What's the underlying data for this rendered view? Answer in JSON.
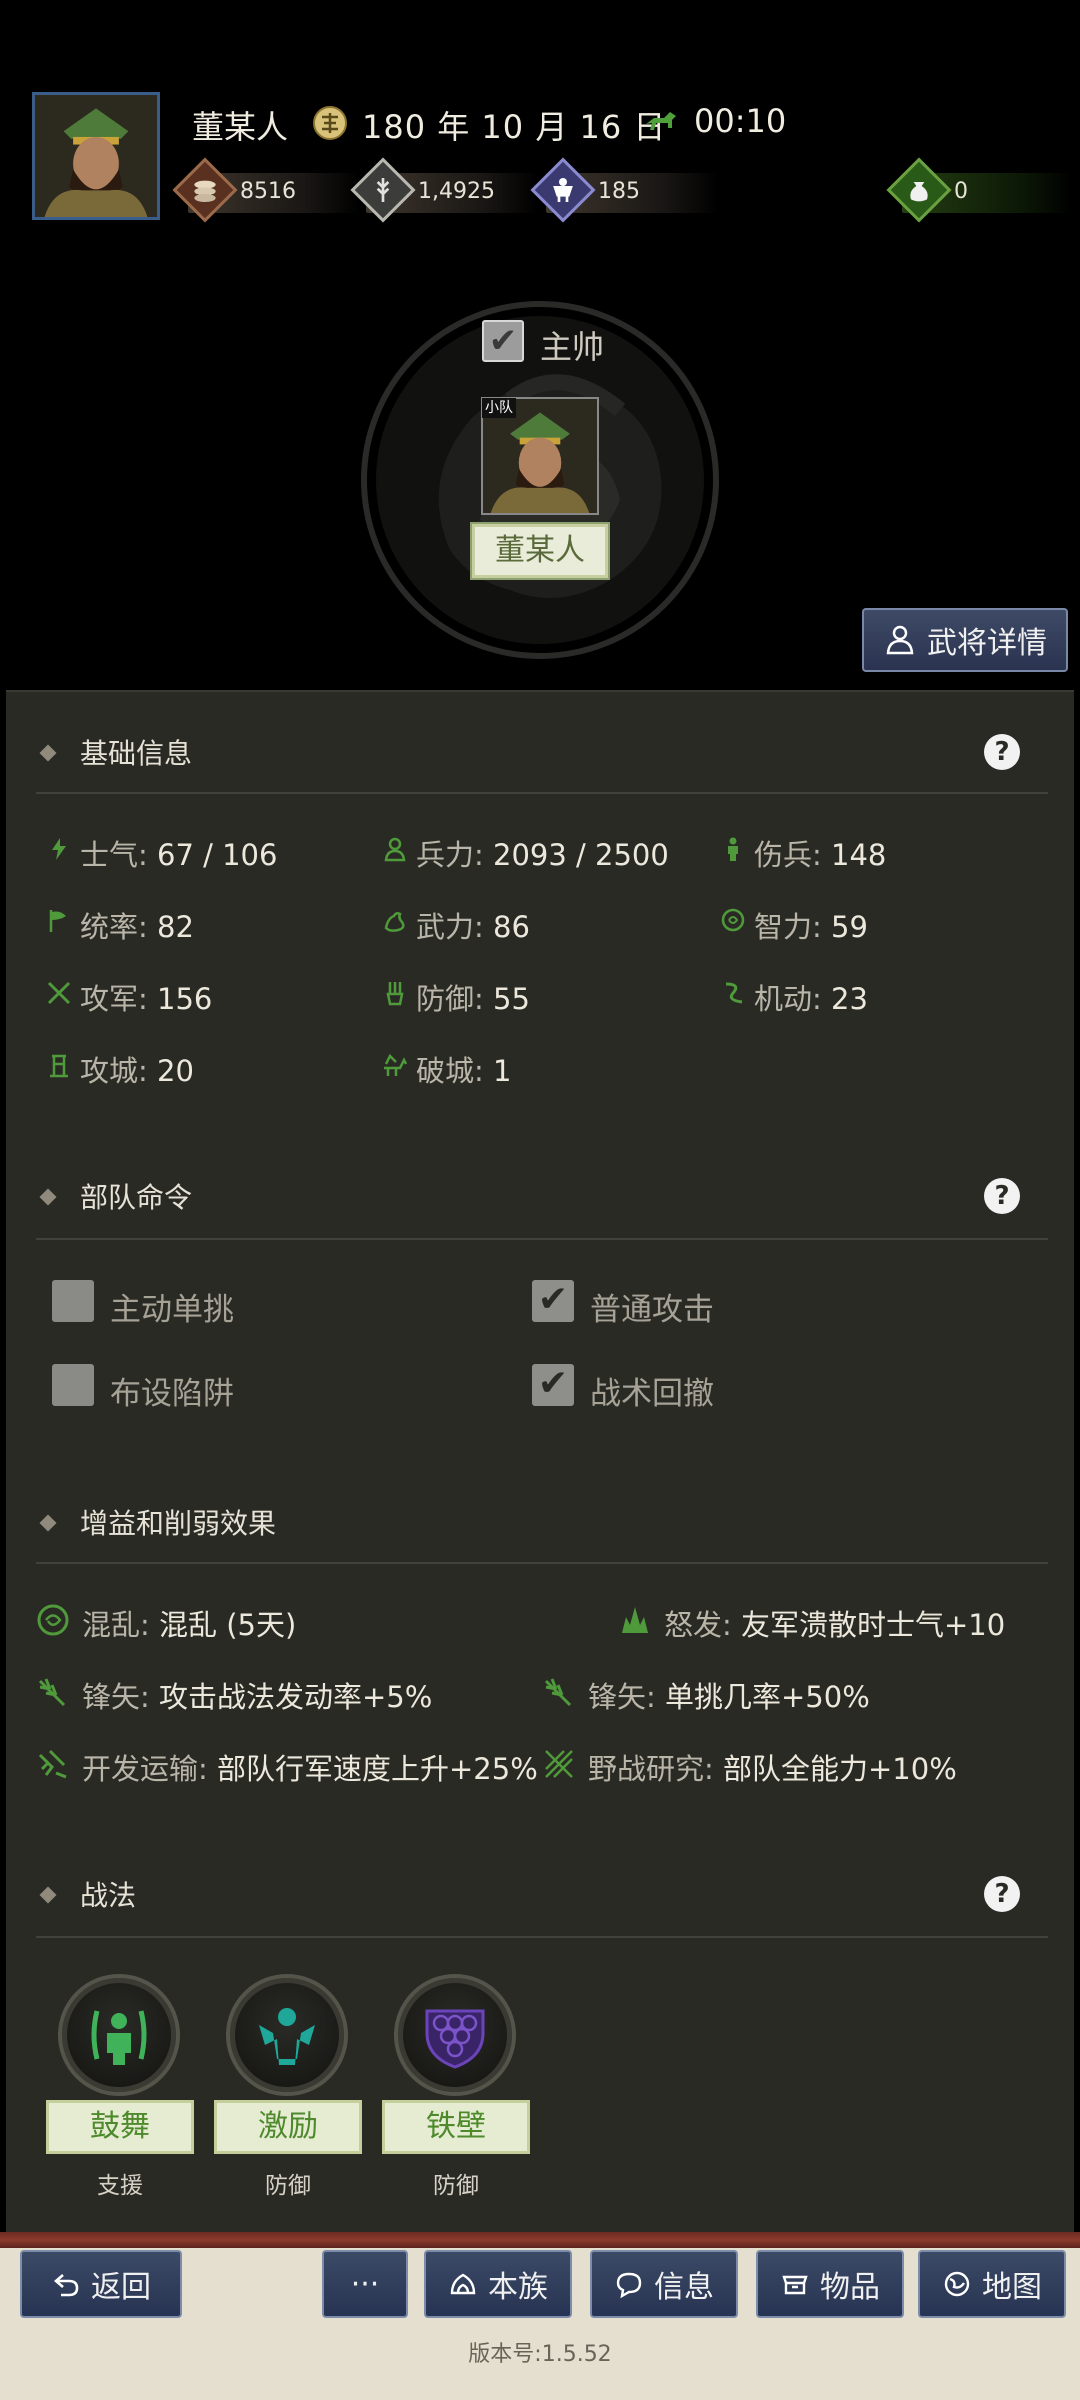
{
  "header": {
    "player_name": "董某人",
    "date": "180 年 10 月 16 日",
    "time": "00:10",
    "resources": [
      {
        "name": "coin",
        "value": "8516"
      },
      {
        "name": "food",
        "value": "1,4925"
      },
      {
        "name": "troops",
        "value": "185"
      },
      {
        "name": "bag",
        "value": "0"
      }
    ]
  },
  "commander": {
    "checkbox_label": "主帅",
    "checked": true,
    "unit_tag": "小队",
    "unit_name": "董某人",
    "detail_button": "武将详情"
  },
  "basic_info": {
    "title": "基础信息",
    "stats": [
      {
        "label": "士气:",
        "value": "67 / 106",
        "icon": "morale-icon"
      },
      {
        "label": "兵力:",
        "value": "2093 / 2500",
        "icon": "troops-icon"
      },
      {
        "label": "伤兵:",
        "value": "148",
        "icon": "wounded-icon"
      },
      {
        "label": "统率:",
        "value": "82",
        "icon": "command-icon"
      },
      {
        "label": "武力:",
        "value": "86",
        "icon": "strength-icon"
      },
      {
        "label": "智力:",
        "value": "59",
        "icon": "intelligence-icon"
      },
      {
        "label": "攻军:",
        "value": "156",
        "icon": "attack-icon"
      },
      {
        "label": "防御:",
        "value": "55",
        "icon": "defense-icon"
      },
      {
        "label": "机动:",
        "value": "23",
        "icon": "mobility-icon"
      },
      {
        "label": "攻城:",
        "value": "20",
        "icon": "siege-icon"
      },
      {
        "label": "破城:",
        "value": "1",
        "icon": "breach-icon"
      }
    ]
  },
  "orders": {
    "title": "部队命令",
    "items": [
      {
        "label": "主动单挑",
        "checked": false
      },
      {
        "label": "普通攻击",
        "checked": true
      },
      {
        "label": "布设陷阱",
        "checked": false
      },
      {
        "label": "战术回撤",
        "checked": true
      }
    ]
  },
  "effects": {
    "title": "增益和削弱效果",
    "items": [
      {
        "label": "混乱:",
        "value": "混乱 (5天)",
        "icon": "confusion-icon"
      },
      {
        "label": "怒发:",
        "value": "友军溃散时士气+10",
        "icon": "rage-icon"
      },
      {
        "label": "锋矢:",
        "value": "攻击战法发动率+5%",
        "icon": "arrow-formation-icon"
      },
      {
        "label": "锋矢:",
        "value": "单挑几率+50%",
        "icon": "arrow-formation-icon"
      },
      {
        "label": "开发运输:",
        "value": "部队行军速度上升+25%",
        "icon": "transport-icon"
      },
      {
        "label": "野战研究:",
        "value": "部队全能力+10%",
        "icon": "field-research-icon"
      }
    ]
  },
  "tactics": {
    "title": "战法",
    "items": [
      {
        "name": "鼓舞",
        "type": "支援",
        "icon": "encourage-icon",
        "color": "#3fb25a"
      },
      {
        "name": "激励",
        "type": "防御",
        "icon": "inspire-icon",
        "color": "#1fa89a"
      },
      {
        "name": "铁壁",
        "type": "防御",
        "icon": "iron-wall-icon",
        "color": "#5a3aa0"
      }
    ]
  },
  "nav": {
    "back": "返回",
    "more": "···",
    "clan": "本族",
    "info": "信息",
    "items": "物品",
    "map": "地图"
  },
  "version": "版本号:1.5.52",
  "colors": {
    "accent_green": "#4e8a2c",
    "button_blue": "#2a3350",
    "panel_bg": "#2a2a25"
  }
}
